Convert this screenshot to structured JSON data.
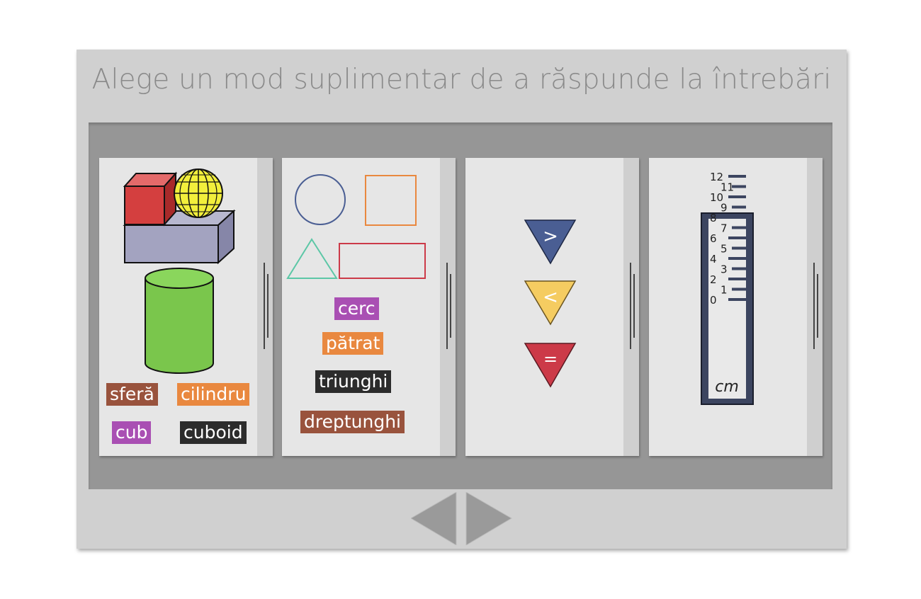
{
  "title": "Alege un mod suplimentar de a răspunde la întrebări",
  "cards": {
    "solids": {
      "labels": {
        "sphere": "sferă",
        "cylinder": "cilindru",
        "cube": "cub",
        "cuboid": "cuboid"
      }
    },
    "shapes": {
      "labels": {
        "circle": "cerc",
        "square": "pătrat",
        "triangle": "triunghi",
        "rectangle": "dreptunghi"
      }
    },
    "compare": {
      "symbols": {
        "greater": ">",
        "less": "<",
        "equal": "="
      }
    },
    "ruler": {
      "unit": "cm",
      "ticks": [
        "0",
        "1",
        "2",
        "3",
        "4",
        "5",
        "6",
        "7",
        "8",
        "9",
        "10",
        "11",
        "12"
      ]
    }
  },
  "colors": {
    "purple": "#a94fb3",
    "orange": "#e9883f",
    "black": "#2c2c2c",
    "brown": "#99533d",
    "navy": "#4a5e93",
    "yellow": "#f5cc61",
    "red": "#cc3a48"
  }
}
